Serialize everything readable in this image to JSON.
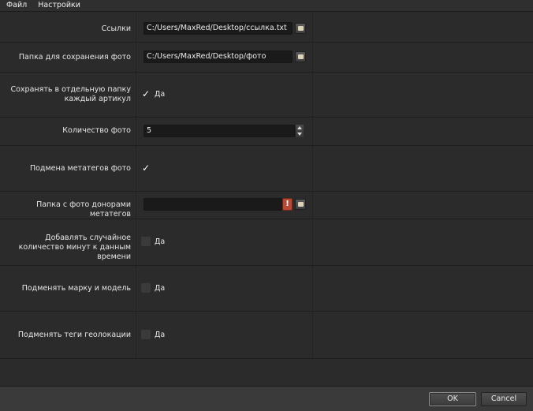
{
  "menu": {
    "file": "Файл",
    "settings": "Настройки"
  },
  "rows": {
    "links": {
      "label": "Ссылки",
      "value": "C:/Users/MaxRed/Desktop/ссылка.txt"
    },
    "photo_folder": {
      "label": "Папка для сохранения фото",
      "value": "C:/Users/MaxRed/Desktop/фото"
    },
    "separate_folder": {
      "label": "Сохранять в отдельную папку каждый артикул",
      "check_text": "Да"
    },
    "photo_count": {
      "label": "Количество фото",
      "value": "5"
    },
    "replace_meta": {
      "label": "Подмена метатегов фото"
    },
    "donor_folder": {
      "label": "Папка с фото донорами метатегов",
      "value": "",
      "warn": "!"
    },
    "random_minutes": {
      "label": "Добавлять случайное количество минут к данным времени",
      "check_text": "Да"
    },
    "replace_make": {
      "label": "Подменять марку и модель",
      "check_text": "Да"
    },
    "replace_geo": {
      "label": "Подменять теги геолокации",
      "check_text": "Да"
    }
  },
  "buttons": {
    "ok": "OK",
    "cancel": "Cancel"
  }
}
